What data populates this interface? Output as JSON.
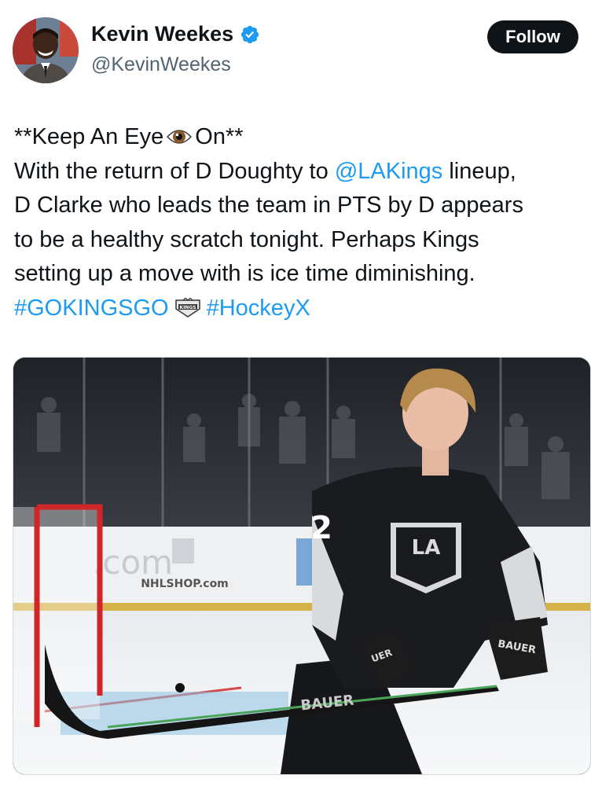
{
  "author": {
    "display_name": "Kevin Weekes",
    "handle": "@KevinWeekes",
    "verified": true,
    "avatar_icon": "profile-photo"
  },
  "follow_label": "Follow",
  "tweet": {
    "line1_pre": "**Keep An Eye",
    "line1_emoji": "eye-icon",
    "line1_post": "On**",
    "line2_pre": "With the return of D Doughty to ",
    "mention": "@LAKings",
    "line2_post": " lineup,",
    "line3": "D Clarke who leads the team in PTS by D appears",
    "line4": "to be a healthy scratch tonight. Perhaps Kings",
    "line5": "setting up a move with is ice time diminishing.",
    "hashtag1": "#GOKINGSGO",
    "hashtag_emoji": "la-kings-logo-icon",
    "hashtag2": "#HockeyX"
  },
  "media": {
    "jersey_logo": "LA",
    "board_text": "NHLSHOP.com",
    "glove_brand": "BAUER",
    "stick_brand": "BAUER",
    "jersey_number": "2"
  },
  "colors": {
    "link": "#1d9bf0",
    "text": "#0f1419",
    "secondary": "#536471",
    "follow_bg": "#0f1419"
  }
}
